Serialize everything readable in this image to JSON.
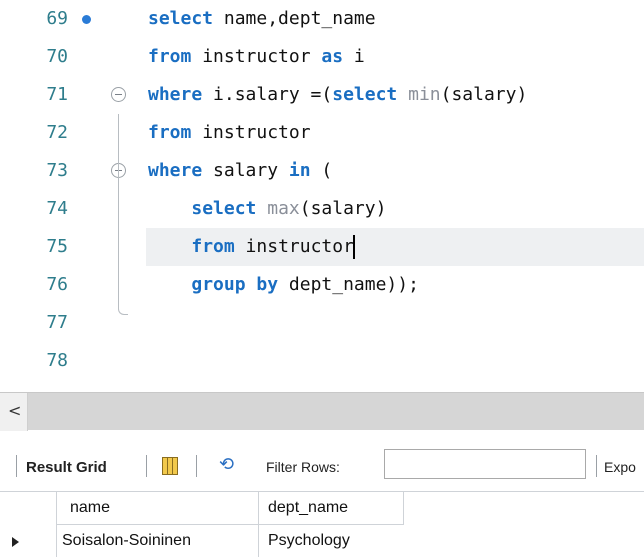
{
  "editor": {
    "lines": [
      {
        "num": "69",
        "tokens": [
          {
            "t": "select",
            "c": "kw"
          },
          {
            "t": " name,dept_name",
            "c": "id"
          }
        ]
      },
      {
        "num": "70",
        "tokens": [
          {
            "t": "from",
            "c": "kw"
          },
          {
            "t": " instructor ",
            "c": "id"
          },
          {
            "t": "as",
            "c": "kw"
          },
          {
            "t": " i",
            "c": "id"
          }
        ]
      },
      {
        "num": "71",
        "tokens": [
          {
            "t": "where",
            "c": "kw"
          },
          {
            "t": " i.salary =(",
            "c": "id"
          },
          {
            "t": "select",
            "c": "kw"
          },
          {
            "t": " ",
            "c": "id"
          },
          {
            "t": "min",
            "c": "fn"
          },
          {
            "t": "(salary)",
            "c": "id"
          }
        ]
      },
      {
        "num": "72",
        "tokens": [
          {
            "t": "from",
            "c": "kw"
          },
          {
            "t": " instructor",
            "c": "id"
          }
        ]
      },
      {
        "num": "73",
        "tokens": [
          {
            "t": "where",
            "c": "kw"
          },
          {
            "t": " salary ",
            "c": "id"
          },
          {
            "t": "in",
            "c": "kw"
          },
          {
            "t": " (",
            "c": "id"
          }
        ]
      },
      {
        "num": "74",
        "tokens": [
          {
            "t": "    ",
            "c": "id"
          },
          {
            "t": "select",
            "c": "kw"
          },
          {
            "t": " ",
            "c": "id"
          },
          {
            "t": "max",
            "c": "fn"
          },
          {
            "t": "(salary)",
            "c": "id"
          }
        ]
      },
      {
        "num": "75",
        "tokens": [
          {
            "t": "    ",
            "c": "id"
          },
          {
            "t": "from",
            "c": "kw"
          },
          {
            "t": " instructor",
            "c": "id"
          }
        ]
      },
      {
        "num": "76",
        "tokens": [
          {
            "t": "    ",
            "c": "id"
          },
          {
            "t": "group by",
            "c": "kw"
          },
          {
            "t": " dept_name));",
            "c": "id"
          }
        ]
      },
      {
        "num": "77",
        "tokens": []
      },
      {
        "num": "78",
        "tokens": []
      }
    ],
    "current_line": "75",
    "executed_marker_line": "69",
    "fold_lines": [
      "71",
      "73"
    ]
  },
  "scrollbar": {
    "left_arrow": "<"
  },
  "toolbar": {
    "result_grid_label": "Result Grid",
    "filter_label": "Filter Rows:",
    "filter_value": "",
    "export_label": "Expo",
    "grid_icon": "grid-layout-icon",
    "refresh_icon": "refresh-arrows-icon"
  },
  "result": {
    "columns": [
      "name",
      "dept_name"
    ],
    "rows": [
      [
        "Soisalon-Soininen",
        "Psychology"
      ]
    ]
  },
  "colors": {
    "keyword": "#1a6ec2",
    "function": "#8a8f99",
    "line_number": "#2e7d8c",
    "current_line_bg": "#eef0f2"
  }
}
